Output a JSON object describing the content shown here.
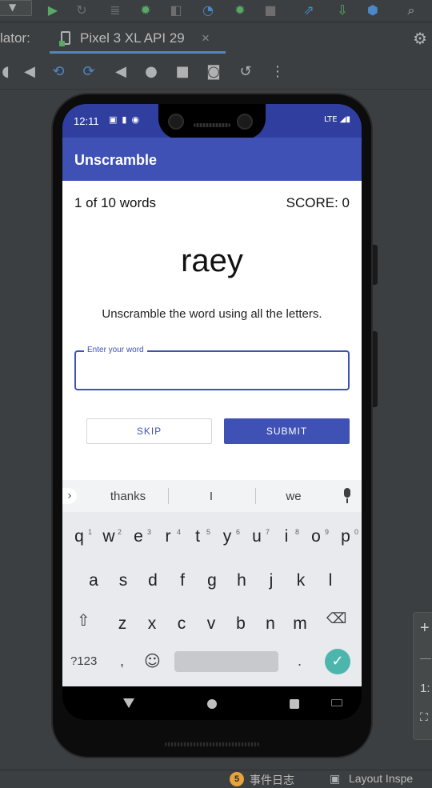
{
  "ide": {
    "tab_prefix": "lator:",
    "tab_label": "Pixel 3 XL API 29",
    "tab_close": "×",
    "status_badge": "5",
    "status_item_1": "事件日志",
    "status_item_2": "Layout Inspe",
    "side_plus": "+",
    "side_ratio": "1:"
  },
  "phone_status": {
    "time": "12:11",
    "network": "LTE"
  },
  "app": {
    "title": "Unscramble",
    "word_count": "1 of 10 words",
    "score": "SCORE: 0",
    "scrambled_word": "raey",
    "instruction": "Unscramble the word using all the letters.",
    "input_label": "Enter your word",
    "input_value": "",
    "skip_label": "SKIP",
    "submit_label": "SUBMIT"
  },
  "keyboard": {
    "suggestions": [
      "thanks",
      "I",
      "we"
    ],
    "row1": [
      "q",
      "w",
      "e",
      "r",
      "t",
      "y",
      "u",
      "i",
      "o",
      "p"
    ],
    "row1_nums": [
      "1",
      "2",
      "3",
      "4",
      "5",
      "6",
      "7",
      "8",
      "9",
      "0"
    ],
    "row2": [
      "a",
      "s",
      "d",
      "f",
      "g",
      "h",
      "j",
      "k",
      "l"
    ],
    "row3": [
      "z",
      "x",
      "c",
      "v",
      "b",
      "n",
      "m"
    ],
    "symbols_key": "?123",
    "comma": ",",
    "period": "."
  },
  "colors": {
    "primary": "#3f51b5",
    "primary_dark": "#303f9f",
    "enter_key": "#4db6ac"
  }
}
